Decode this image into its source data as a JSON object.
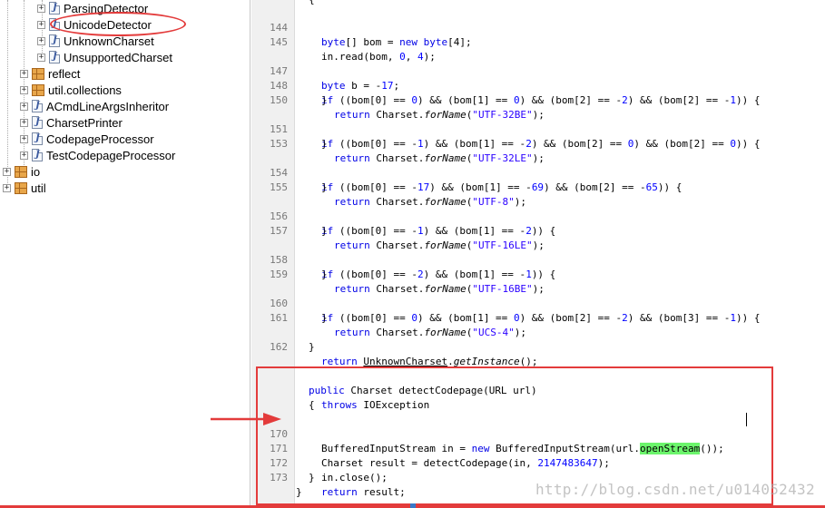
{
  "tree": {
    "items": [
      {
        "label": "ParsingDetector",
        "type": "java"
      },
      {
        "label": "UnicodeDetector",
        "type": "java"
      },
      {
        "label": "UnknownCharset",
        "type": "java"
      },
      {
        "label": "UnsupportedCharset",
        "type": "java"
      },
      {
        "label": "reflect",
        "type": "package"
      },
      {
        "label": "util.collections",
        "type": "package"
      },
      {
        "label": "ACmdLineArgsInheritor",
        "type": "java"
      },
      {
        "label": "CharsetPrinter",
        "type": "java"
      },
      {
        "label": "CodepageProcessor",
        "type": "java"
      },
      {
        "label": "TestCodepageProcessor",
        "type": "java"
      },
      {
        "label": "io",
        "type": "package"
      },
      {
        "label": "util",
        "type": "package"
      }
    ]
  },
  "editor": {
    "line_numbers": [
      "144",
      "145",
      "147",
      "148",
      "150",
      "151",
      "153",
      "154",
      "155",
      "156",
      "157",
      "158",
      "159",
      "160",
      "161",
      "162",
      "170",
      "171",
      "172",
      "173"
    ]
  },
  "watermark": "http://blog.csdn.net/u014052432",
  "colors": {
    "annotation_red": "#e33b3b",
    "highlight_green": "#6cf56c"
  }
}
